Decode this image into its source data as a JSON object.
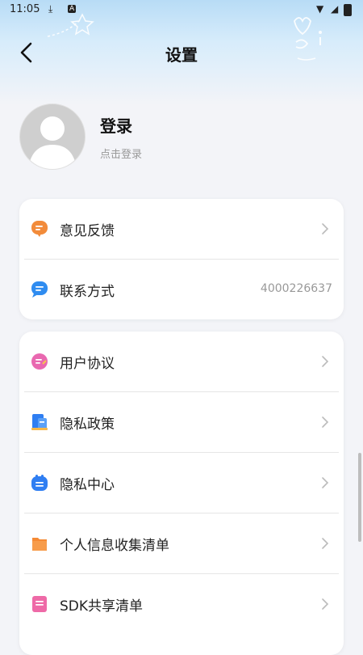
{
  "status_bar": {
    "time": "11:05"
  },
  "header": {
    "title": "设置"
  },
  "profile": {
    "title": "登录",
    "subtitle": "点击登录"
  },
  "group1": [
    {
      "label": "意见反馈",
      "icon": "feedback-icon",
      "color": "#f28b3a"
    },
    {
      "label": "联系方式",
      "icon": "contact-icon",
      "color": "#2f8cf0",
      "value": "4000226637"
    }
  ],
  "group2": [
    {
      "label": "用户协议",
      "icon": "user-agreement-icon",
      "color": "#e968b0"
    },
    {
      "label": "隐私政策",
      "icon": "privacy-policy-icon",
      "color": "#2f7ef2"
    },
    {
      "label": "隐私中心",
      "icon": "privacy-center-icon",
      "color": "#2f7ef2"
    },
    {
      "label": "个人信息收集清单",
      "icon": "personal-info-icon",
      "color": "#f58a35"
    },
    {
      "label": "SDK共享清单",
      "icon": "sdk-share-icon",
      "color": "#ee6aa7"
    }
  ]
}
